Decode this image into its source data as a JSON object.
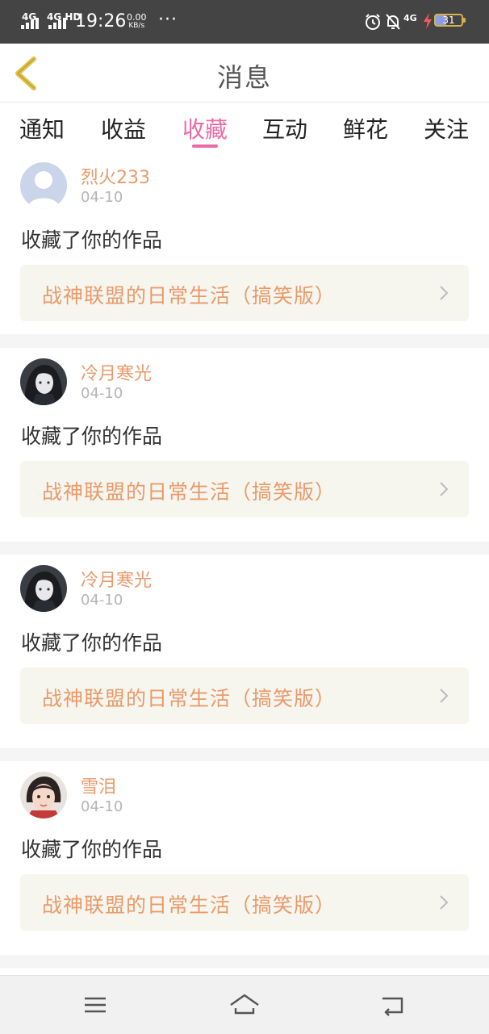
{
  "status_bar": {
    "network_1": "4G",
    "network_2": "4G HD",
    "time": "19:26",
    "speed_value": "0.00",
    "speed_unit": "KB/s",
    "more": "···",
    "network_3": "4G",
    "battery": "31",
    "icons": [
      "alarm-icon",
      "bell-off-icon",
      "charging-icon"
    ]
  },
  "header": {
    "title": "消息",
    "back_icon": "chevron-left-icon"
  },
  "tabs": {
    "items": [
      "通知",
      "收益",
      "收藏",
      "互动",
      "鲜花",
      "关注"
    ],
    "active_index": 2
  },
  "notifications": [
    {
      "user": "烈火233",
      "date": "04-10",
      "action": "收藏了你的作品",
      "work": "战神联盟的日常生活（搞笑版）",
      "avatar": "default-avatar"
    },
    {
      "user": "冷月寒光",
      "date": "04-10",
      "action": "收藏了你的作品",
      "work": "战神联盟的日常生活（搞笑版）",
      "avatar": "anime-avatar"
    },
    {
      "user": "冷月寒光",
      "date": "04-10",
      "action": "收藏了你的作品",
      "work": "战神联盟的日常生活（搞笑版）",
      "avatar": "anime-avatar"
    },
    {
      "user": "雪泪",
      "date": "04-10",
      "action": "收藏了你的作品",
      "work": "战神联盟的日常生活（搞笑版）",
      "avatar": "photo-avatar"
    }
  ],
  "nav_bar": {
    "buttons": [
      "menu-icon",
      "home-icon",
      "back-icon"
    ]
  },
  "colors": {
    "accent": "#ea6aa6",
    "name": "#e99a6b",
    "status_bar": "#444444",
    "link_bg": "#f6f6ef"
  }
}
